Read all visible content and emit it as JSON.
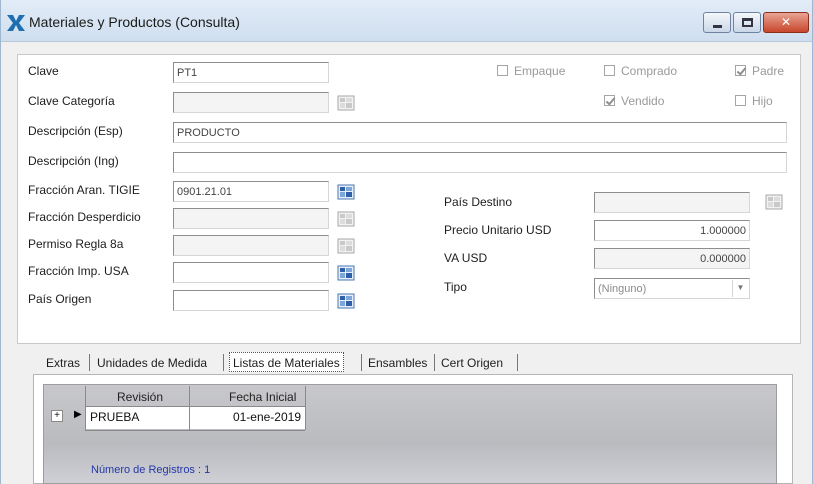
{
  "window": {
    "title": "Materiales y Productos (Consulta)"
  },
  "form": {
    "clave": {
      "label": "Clave",
      "value": "PT1"
    },
    "clave_categoria": {
      "label": "Clave Categoría",
      "value": ""
    },
    "descripcion_esp": {
      "label": "Descripción (Esp)",
      "value": "PRODUCTO"
    },
    "descripcion_ing": {
      "label": "Descripción (Ing)",
      "value": ""
    },
    "fraccion_aran": {
      "label": "Fracción Aran. TIGIE",
      "value": "0901.21.01"
    },
    "fraccion_desperdicio": {
      "label": "Fracción Desperdicio",
      "value": ""
    },
    "permiso_regla": {
      "label": "Permiso Regla 8a",
      "value": ""
    },
    "fraccion_imp_usa": {
      "label": "Fracción Imp. USA",
      "value": ""
    },
    "pais_origen": {
      "label": "País Origen",
      "value": ""
    },
    "pais_destino": {
      "label": "País Destino",
      "value": ""
    },
    "precio_unitario": {
      "label": "Precio Unitario USD",
      "value": "1.000000"
    },
    "va_usd": {
      "label": "VA USD",
      "value": "0.000000"
    },
    "tipo": {
      "label": "Tipo",
      "value": "(Ninguno)"
    }
  },
  "checkboxes": {
    "empaque": {
      "label": "Empaque",
      "checked": false
    },
    "comprado": {
      "label": "Comprado",
      "checked": false
    },
    "padre": {
      "label": "Padre",
      "checked": true
    },
    "vendido": {
      "label": "Vendido",
      "checked": true
    },
    "hijo": {
      "label": "Hijo",
      "checked": false
    }
  },
  "tabs": [
    {
      "label": "Extras",
      "active": false
    },
    {
      "label": "Unidades de Medida",
      "active": false
    },
    {
      "label": "Listas de Materiales",
      "active": true
    },
    {
      "label": "Ensambles",
      "active": false
    },
    {
      "label": "Cert Origen",
      "active": false
    }
  ],
  "grid": {
    "columns": [
      "Revisión",
      "Fecha Inicial"
    ],
    "rows": [
      {
        "revision": "PRUEBA",
        "fecha_inicial": "01-ene-2019"
      }
    ],
    "records_text": "Número de Registros : 1"
  },
  "colors": {
    "title_icon": "#1f6fb0",
    "records_text": "#2438a8"
  }
}
